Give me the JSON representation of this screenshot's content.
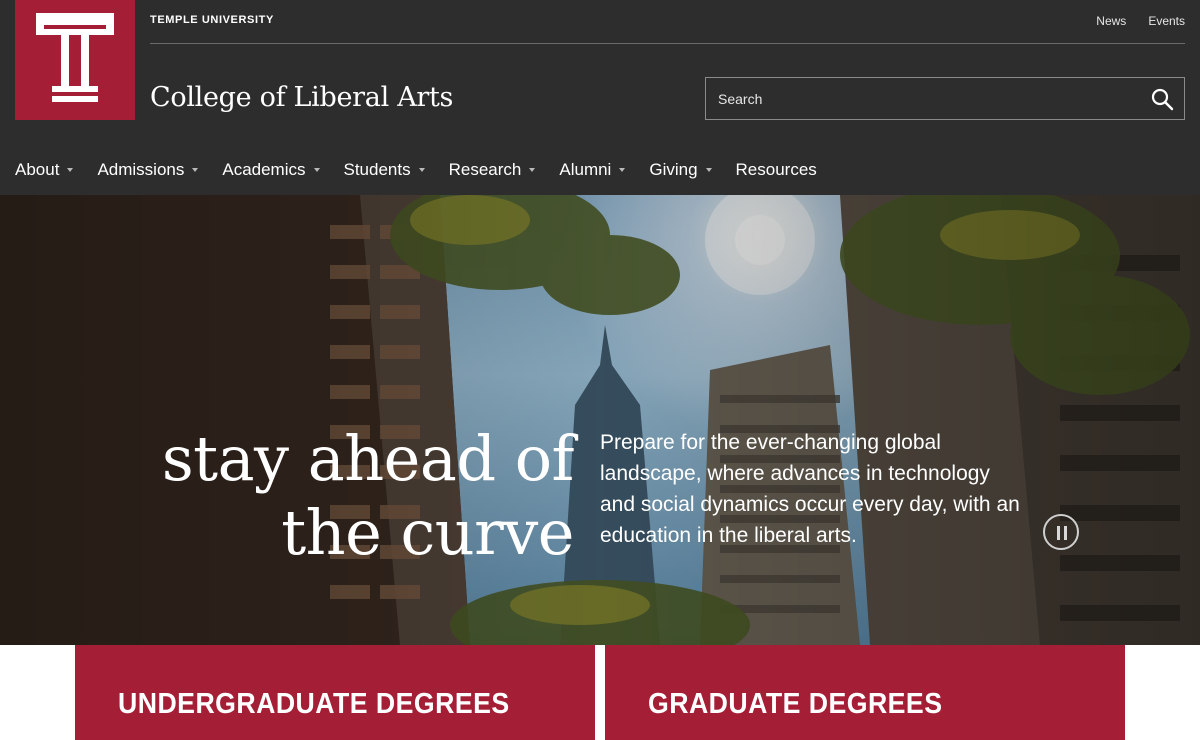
{
  "header": {
    "university": "TEMPLE UNIVERSITY",
    "college": "College of Liberal Arts",
    "logo_icon": "temple-t-logo",
    "colors": {
      "brand": "#a41e35",
      "header_bg": "#2d2d2d"
    }
  },
  "utility_nav": [
    {
      "label": "News"
    },
    {
      "label": "Events"
    }
  ],
  "search": {
    "placeholder": "Search",
    "icon": "search-icon"
  },
  "main_nav": [
    {
      "label": "About",
      "has_dropdown": true
    },
    {
      "label": "Admissions",
      "has_dropdown": true
    },
    {
      "label": "Academics",
      "has_dropdown": true
    },
    {
      "label": "Students",
      "has_dropdown": true
    },
    {
      "label": "Research",
      "has_dropdown": true
    },
    {
      "label": "Alumni",
      "has_dropdown": true
    },
    {
      "label": "Giving",
      "has_dropdown": true
    },
    {
      "label": "Resources",
      "has_dropdown": false
    }
  ],
  "hero": {
    "headline_line1": "stay ahead of",
    "headline_line2": "the curve",
    "blurb": "Prepare for the ever-changing global landscape, where advances in technology and social dynamics occur every day, with an education in the liberal arts.",
    "pause_icon": "pause-icon"
  },
  "cards": [
    {
      "label": "UNDERGRADUATE DEGREES"
    },
    {
      "label": "GRADUATE DEGREES"
    }
  ]
}
